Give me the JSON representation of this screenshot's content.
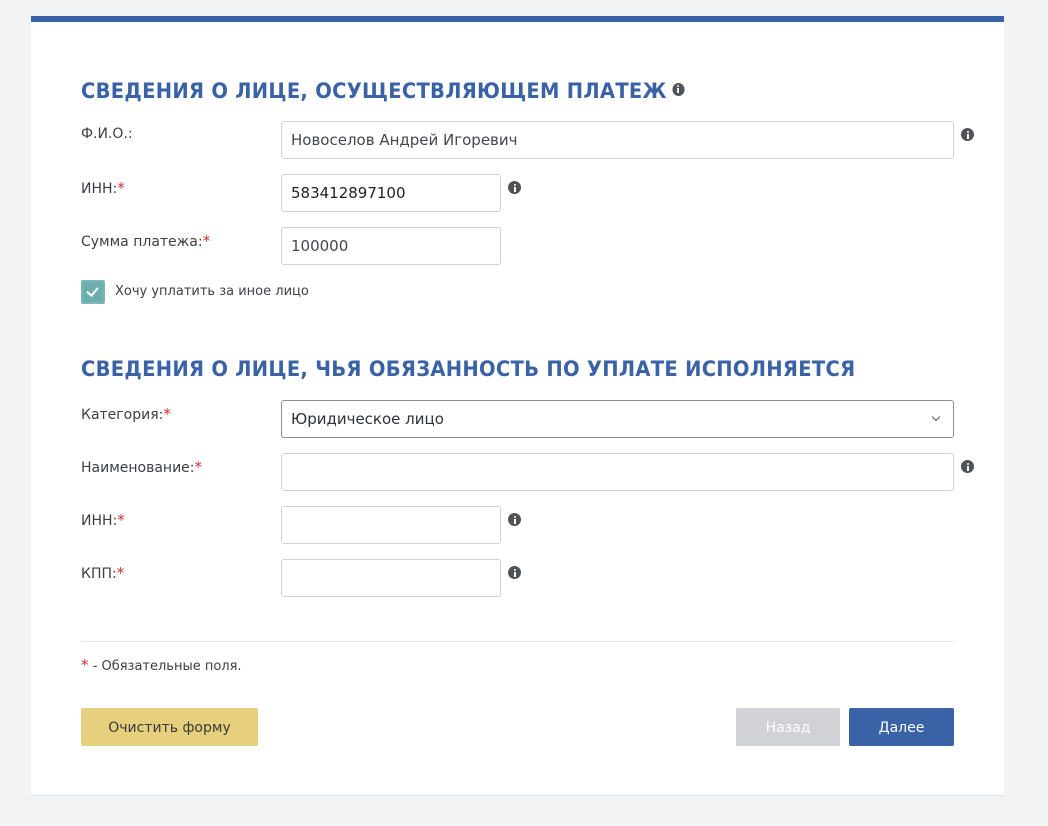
{
  "section_payer": {
    "title": "СВЕДЕНИЯ О ЛИЦЕ, ОСУЩЕСТВЛЯЮЩЕМ ПЛАТЕЖ",
    "fio_label": "Ф.И.О.:",
    "fio_value": "Новоселов Андрей Игоревич",
    "inn_label": "ИНН:",
    "inn_value": "583412897100",
    "sum_label": "Сумма платежа:",
    "sum_value": "100000",
    "other_person_checkbox_label": "Хочу уплатить за иное лицо",
    "other_person_checked": true
  },
  "section_obligor": {
    "title": "СВЕДЕНИЯ О ЛИЦЕ, ЧЬЯ ОБЯЗАННОСТЬ ПО УПЛАТЕ ИСПОЛНЯЕТСЯ",
    "category_label": "Категория:",
    "category_value": "Юридическое лицо",
    "name_label": "Наименование:",
    "name_value": "",
    "inn_label": "ИНН:",
    "inn_value": "",
    "kpp_label": "КПП:",
    "kpp_value": ""
  },
  "required_marker": "*",
  "footnote": {
    "marker": "*",
    "text": " - Обязательные поля."
  },
  "buttons": {
    "clear_label": "Очистить форму",
    "back_label": "Назад",
    "next_label": "Далее"
  },
  "icons": {
    "info": "info-icon",
    "checkmark": "checkmark-icon",
    "dropdown": "chevron-down-icon"
  },
  "colors": {
    "accent": "#3a62a6",
    "required": "#d0312d",
    "checkbox": "#6aaeae",
    "clear_button": "#e6cf7d",
    "disabled_button": "#d0d2d5"
  }
}
